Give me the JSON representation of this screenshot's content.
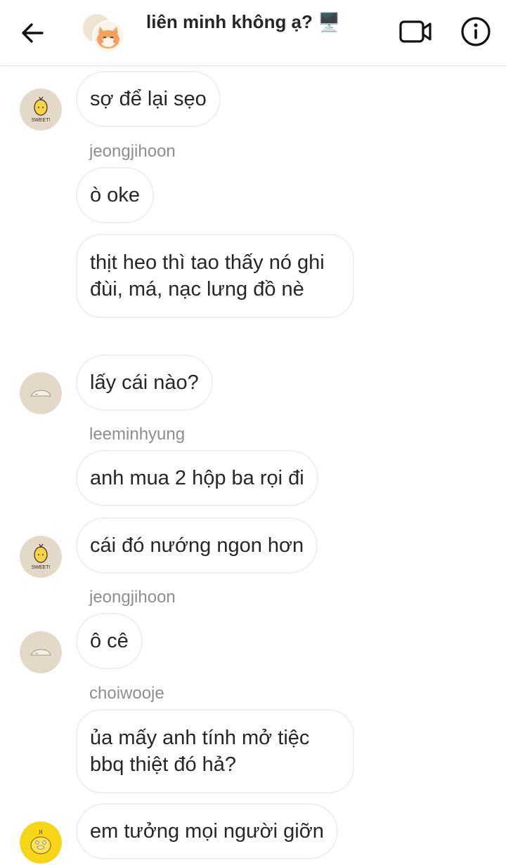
{
  "header": {
    "title": "liên minh không ạ? 🖥️",
    "back_icon": "arrow-left-icon",
    "video_icon": "video-camera-icon",
    "info_icon": "info-icon"
  },
  "messages": [
    {
      "sender": "",
      "text": "sợ để lại sẹo",
      "avatar": "sweet-potato"
    },
    {
      "sender": "jeongjihoon",
      "text": "ò oke",
      "avatar": ""
    },
    {
      "sender": "",
      "text": "thịt heo thì tao thấy nó ghi đùi, má, nạc lưng đồ nè",
      "avatar": ""
    },
    {
      "sender": "",
      "text": "lấy cái nào?",
      "avatar": "sleeping-cat"
    },
    {
      "sender": "leeminhyung",
      "text": "anh mua 2 hộp ba rọi đi",
      "avatar": ""
    },
    {
      "sender": "",
      "text": "cái đó nướng ngon hơn",
      "avatar": "sweet-potato"
    },
    {
      "sender": "jeongjihoon",
      "text": "ô cê",
      "avatar": "sleeping-cat"
    },
    {
      "sender": "choiwooje",
      "text": "ủa mấy anh tính mở tiệc bbq thiệt đó hả?",
      "avatar": ""
    },
    {
      "sender": "",
      "text": "em tưởng mọi người giỡn",
      "avatar": "yellow-duck"
    }
  ],
  "avatar_text": {
    "sweet": "SWEET!"
  },
  "colors": {
    "bubble_border": "#efefef",
    "sender": "#8e8e8e",
    "text": "#262626",
    "avatar_beige": "#e4d8c8",
    "duck_yellow": "#f5d515"
  }
}
